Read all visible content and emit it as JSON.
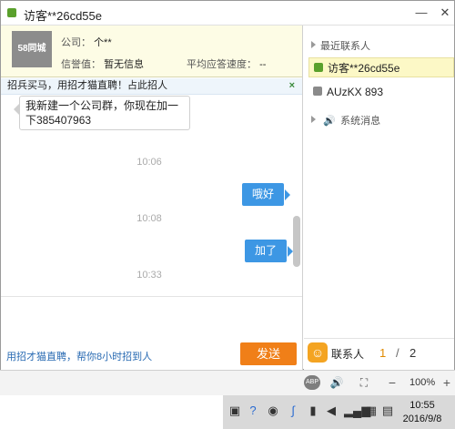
{
  "window": {
    "title": "访客**26cd55e",
    "minimize": "—",
    "close": "✕"
  },
  "info": {
    "logo": "58同城",
    "company_label": "公司：",
    "company_value": "个**",
    "credit_label": "信誉值：",
    "credit_value": "暂无信息",
    "speed_label": "平均应答速度：",
    "speed_value": "--"
  },
  "banner": {
    "text": "招兵买马，用招才猫直聘！占此招人",
    "close": "×"
  },
  "messages": [
    {
      "side": "left",
      "text": "我新建一个公司群，你现在加一下385407963"
    },
    {
      "type": "time",
      "text": "10:06"
    },
    {
      "side": "right",
      "text": "哦好"
    },
    {
      "type": "time",
      "text": "10:08"
    },
    {
      "side": "right",
      "text": "加了"
    },
    {
      "type": "time",
      "text": "10:33"
    }
  ],
  "input": {
    "tip": "用招才猫直聘，帮你8小时招到人",
    "send_label": "发送"
  },
  "sidebar": {
    "recent_header": "最近联系人",
    "contacts": [
      {
        "name": "访客**26cd55e",
        "status_color": "#5aa02c",
        "active": true
      },
      {
        "name": "AUzKX  893",
        "status_color": "#8a8a8a",
        "active": false
      }
    ],
    "system_msg": "系统消息",
    "bottom": {
      "label": "联系人",
      "page_current": "1",
      "page_sep": "/",
      "page_total": "2"
    }
  },
  "statusbar": {
    "abp": "ABP",
    "zoom": "100%"
  },
  "taskbar": {
    "time": "10:55",
    "date": "2016/9/8"
  },
  "colors": {
    "accent_green": "#5aa02c",
    "send_orange": "#f07f18",
    "bubble_blue": "#3d97e4"
  }
}
